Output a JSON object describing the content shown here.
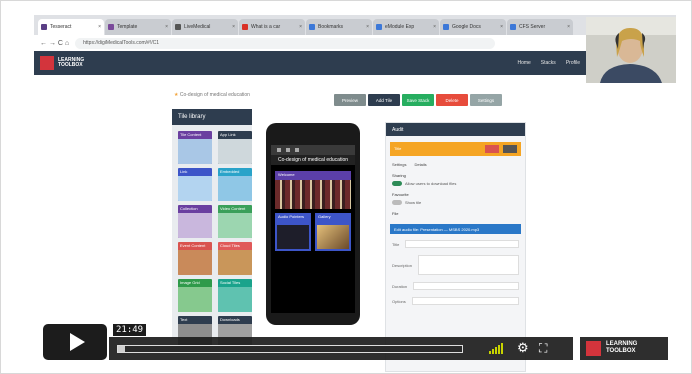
{
  "browser": {
    "tabs": [
      {
        "label": "Tesseract",
        "color": "#5a3e85",
        "close": "×"
      },
      {
        "label": "Template",
        "color": "#7a4a9a",
        "close": "×"
      },
      {
        "label": "LiveMedical",
        "color": "#555555",
        "close": "×"
      },
      {
        "label": "What is a car",
        "color": "#d93025",
        "close": "×"
      },
      {
        "label": "Bookmarks",
        "color": "#3c78d8",
        "close": "×"
      },
      {
        "label": "eModule Exp",
        "color": "#3c78d8",
        "close": "×"
      },
      {
        "label": "Google Docs",
        "color": "#3c78d8",
        "close": "×"
      },
      {
        "label": "CFS Server",
        "color": "#3c78d8",
        "close": "×"
      }
    ],
    "nav_symbols": "← → C ⌂",
    "url": "https://digiMedicalTools.com/#!/C1"
  },
  "site": {
    "name": "LEARNING TOOLBOX",
    "nav": [
      "Home",
      "Stacks",
      "Profile"
    ]
  },
  "editor": {
    "breadcrumb": "Co-design of medical education",
    "toolbar": [
      {
        "label": "Preview",
        "color": "#7f8c8d"
      },
      {
        "label": "Add Tile",
        "color": "#2e3d4f"
      },
      {
        "label": "Save Stack",
        "color": "#27ae60"
      },
      {
        "label": "Delete",
        "color": "#e74c3c"
      },
      {
        "label": "Settings",
        "color": "#95a5a6"
      }
    ],
    "library_title": "Tile library",
    "library_tiles": [
      {
        "label": "Tile Content",
        "color": "#6a3fa0",
        "art": "#a9c7e6"
      },
      {
        "label": "App Link",
        "color": "#2e3d4f",
        "art": "#cfd8dc"
      },
      {
        "label": "Link",
        "color": "#3d55c8",
        "art": "#b3d4f0"
      },
      {
        "label": "Embedded",
        "color": "#2aa3c9",
        "art": "#8fc7e6"
      },
      {
        "label": "Collection",
        "color": "#6a3fa0",
        "art": "#c9b7dd"
      },
      {
        "label": "Video Content",
        "color": "#3aa05a",
        "art": "#9cd6b0"
      },
      {
        "label": "Event Content",
        "color": "#d9534f",
        "art": "#c98a5a"
      },
      {
        "label": "Cloud Tiles",
        "color": "#e05a5a",
        "art": "#c9965a"
      },
      {
        "label": "Image Grid",
        "color": "#2f9a4a",
        "art": "#86c98e"
      },
      {
        "label": "Social Tiles",
        "color": "#1aa38c",
        "art": "#5fc2b0"
      },
      {
        "label": "Text",
        "color": "#2e3d4f",
        "art": "#8e8e8e"
      },
      {
        "label": "Downloads",
        "color": "#2e3d4f",
        "art": "#a0a0a0"
      }
    ],
    "phone": {
      "title": "Co-design of medical education",
      "tiles": [
        {
          "label": "Welcome",
          "color": "#5b3fa8"
        },
        {
          "label": "Audio Pointers",
          "color": "#3d55c8"
        },
        {
          "label": "Gallery",
          "color": "#3d55c8"
        }
      ]
    },
    "panel": {
      "title": "Audit",
      "sub_title": "Title",
      "tabs": [
        "Settings",
        "Details"
      ],
      "tile_label": "Sharing",
      "toggle1": "Allow users to download files",
      "toggle2_label": "Favourite",
      "toggle2": "Show tile",
      "file_label": "File",
      "file_band": "Edit audio file: Presentation — MSBS 2020.mp3",
      "form_rows": [
        "Title",
        "Description",
        "Duration",
        "Options"
      ]
    }
  },
  "player": {
    "time": "21:49",
    "progress": 0.02,
    "brand": "LEARNING TOOLBOX",
    "settings_icon": "⚙",
    "fullscreen_icon": "⛶"
  }
}
